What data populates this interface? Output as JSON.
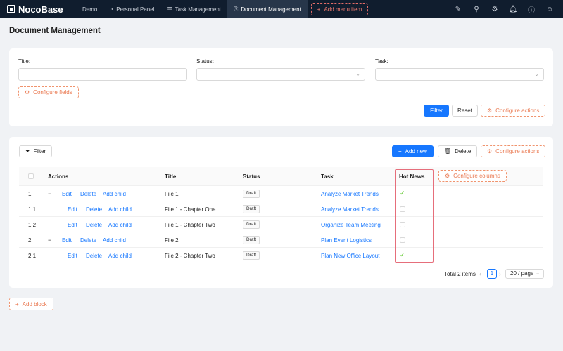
{
  "nav": {
    "logo": "NocoBase",
    "items": [
      {
        "label": "Demo",
        "icon": ""
      },
      {
        "label": "Personal Panel",
        "icon": "◔"
      },
      {
        "label": "Task Management",
        "icon": "☰"
      },
      {
        "label": "Document Management",
        "icon": "⎘"
      }
    ],
    "add_menu_item": "Add menu item",
    "right_icons": [
      "brush-icon",
      "plugin-icon",
      "settings-icon",
      "bell-icon",
      "help-icon",
      "user-icon"
    ]
  },
  "page": {
    "title": "Document Management"
  },
  "filter_form": {
    "fields": [
      {
        "label": "Title",
        "colon": ":",
        "type": "text",
        "value": ""
      },
      {
        "label": "Status",
        "colon": ":",
        "type": "select",
        "value": ""
      },
      {
        "label": "Task",
        "colon": ":",
        "type": "select",
        "value": ""
      }
    ],
    "configure_fields": "Configure fields",
    "filter_button": "Filter",
    "reset_button": "Reset",
    "configure_actions": "Configure actions"
  },
  "table_block": {
    "filter_button": "Filter",
    "add_new_button": "Add new",
    "delete_button": "Delete",
    "configure_actions": "Configure actions",
    "configure_columns": "Configure columns",
    "columns": [
      "Actions",
      "Title",
      "Status",
      "Task",
      "Hot News"
    ],
    "action_labels": {
      "edit": "Edit",
      "delete": "Delete",
      "add_child": "Add child"
    },
    "rows": [
      {
        "index": "1",
        "expanded": true,
        "child": false,
        "title": "File 1",
        "status": "Draft",
        "task": "Analyze Market Trends",
        "hot_news": true
      },
      {
        "index": "1.1",
        "expanded": false,
        "child": true,
        "title": "File 1 - Chapter One",
        "status": "Draft",
        "task": "Analyze Market Trends",
        "hot_news": false
      },
      {
        "index": "1.2",
        "expanded": false,
        "child": true,
        "title": "File 1 - Chapter Two",
        "status": "Draft",
        "task": "Organize Team Meeting",
        "hot_news": false
      },
      {
        "index": "2",
        "expanded": true,
        "child": false,
        "title": "File 2",
        "status": "Draft",
        "task": "Plan Event Logistics",
        "hot_news": false
      },
      {
        "index": "2.1",
        "expanded": false,
        "child": true,
        "title": "File 2 - Chapter Two",
        "status": "Draft",
        "task": "Plan New Office Layout",
        "hot_news": true
      }
    ],
    "pagination": {
      "total_text": "Total 2 items",
      "current_page": "1",
      "page_size": "20 / page"
    }
  },
  "add_block": "Add block",
  "colors": {
    "nav_bg": "#101d2e",
    "primary": "#1677ff",
    "config_dashed": "#ea7a52",
    "highlight_outline": "#e66e7b",
    "check_green": "#52c41a"
  }
}
